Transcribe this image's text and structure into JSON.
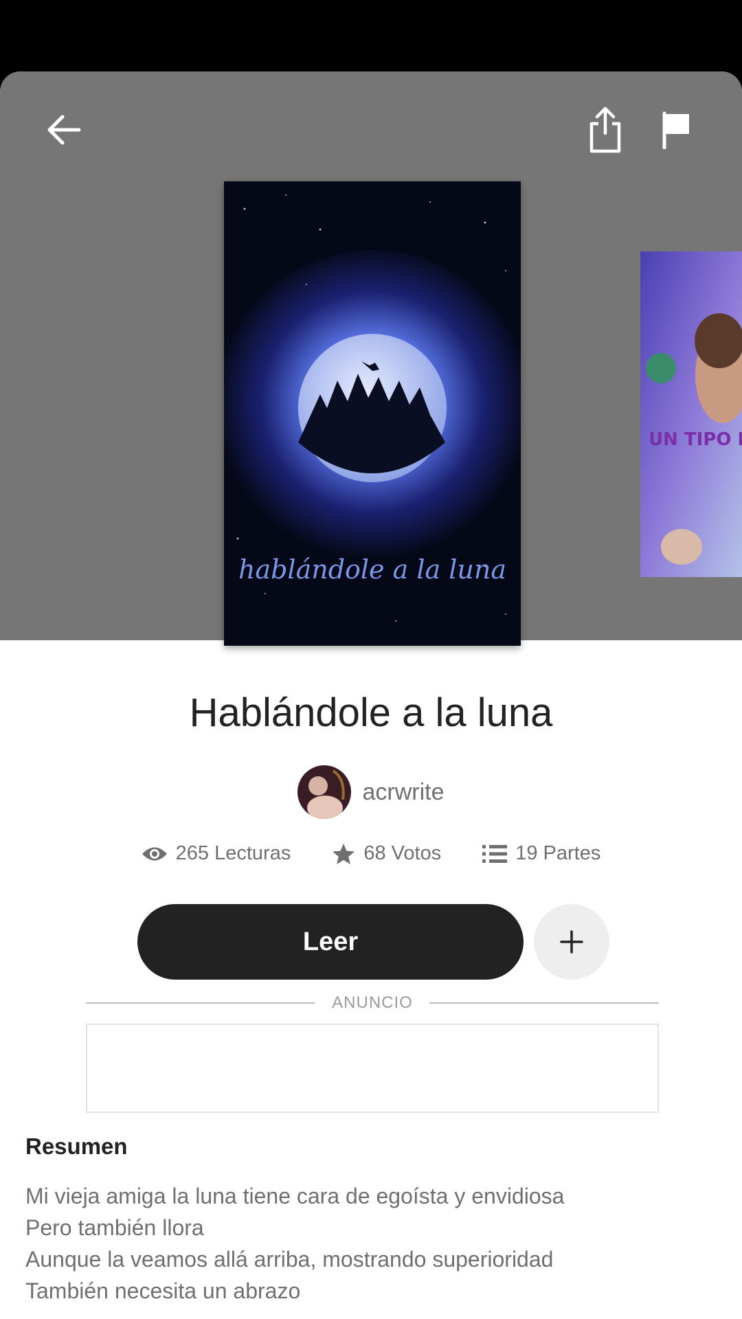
{
  "header": {
    "back_icon": "arrow-left-icon",
    "share_icon": "share-icon",
    "report_icon": "flag-icon"
  },
  "story": {
    "cover_text": "hablándole a la luna",
    "next_cover_text": "UN TIPO DE HUM",
    "title": "Hablándole a la luna",
    "author": "acrwrite"
  },
  "stats": {
    "reads": "265 Lecturas",
    "votes": "68 Votos",
    "parts": "19 Partes"
  },
  "actions": {
    "read_label": "Leer"
  },
  "ad": {
    "label": "ANUNCIO"
  },
  "summary": {
    "heading": "Resumen",
    "lines": [
      "Mi vieja amiga la luna tiene cara de egoísta y envidiosa",
      "Pero también llora",
      "Aunque la veamos allá arriba, mostrando superioridad",
      "También necesita un abrazo"
    ]
  },
  "colors": {
    "header_bg": "#767676",
    "primary_button": "#222222",
    "secondary_button": "#eeeeee",
    "muted_text": "#6f6f6f"
  }
}
